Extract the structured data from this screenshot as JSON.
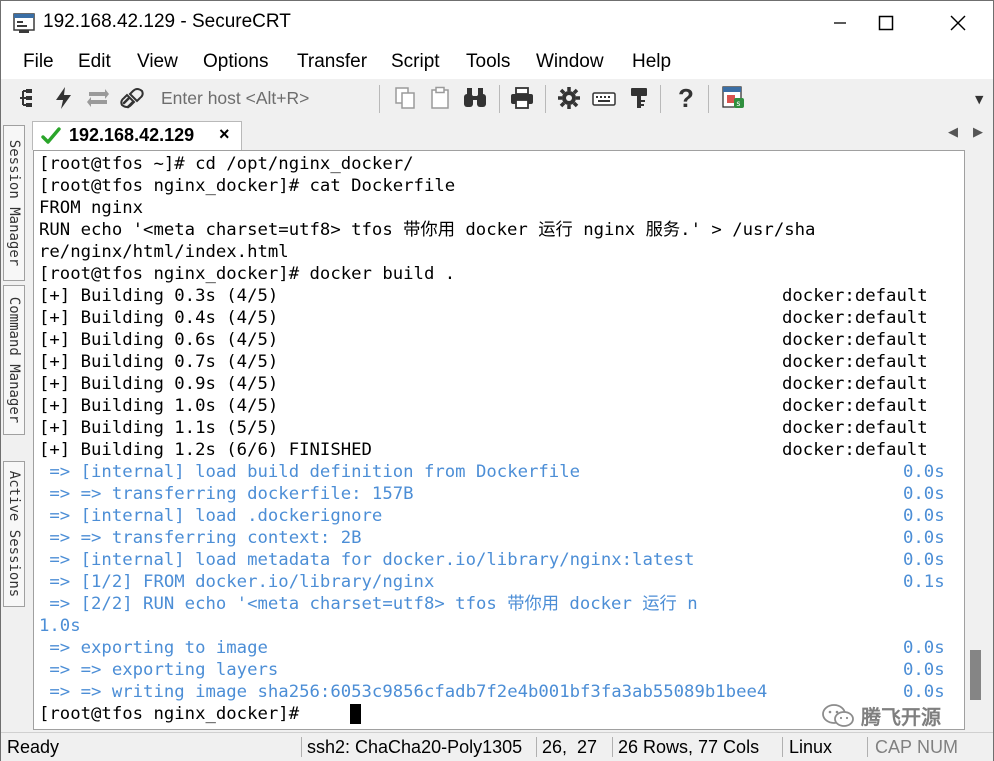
{
  "window": {
    "title": "192.168.42.129 - SecureCRT"
  },
  "menu": [
    "File",
    "Edit",
    "View",
    "Options",
    "Transfer",
    "Script",
    "Tools",
    "Window",
    "Help"
  ],
  "toolbar": {
    "host_placeholder": "Enter host <Alt+R>"
  },
  "side_panel": {
    "tabs": [
      "Session Manager",
      "Command Manager",
      "Active Sessions"
    ]
  },
  "tabs": [
    {
      "label": "192.168.42.129",
      "close": "×",
      "status": "connected"
    }
  ],
  "terminal": {
    "lines": [
      "[root@tfos ~]# cd /opt/nginx_docker/",
      "[root@tfos nginx_docker]# cat Dockerfile",
      "FROM nginx",
      "RUN echo '<meta charset=utf8> tfos 带你用 docker 运行 nginx 服务.' > /usr/sha",
      "re/nginx/html/index.html",
      "[root@tfos nginx_docker]# docker build ."
    ],
    "build_progress": [
      {
        "text": "[+] Building 0.3s (4/5)",
        "target": "docker:default"
      },
      {
        "text": "[+] Building 0.4s (4/5)",
        "target": "docker:default"
      },
      {
        "text": "[+] Building 0.6s (4/5)",
        "target": "docker:default"
      },
      {
        "text": "[+] Building 0.7s (4/5)",
        "target": "docker:default"
      },
      {
        "text": "[+] Building 0.9s (4/5)",
        "target": "docker:default"
      },
      {
        "text": "[+] Building 1.0s (4/5)",
        "target": "docker:default"
      },
      {
        "text": "[+] Building 1.1s (5/5)",
        "target": "docker:default"
      },
      {
        "text": "[+] Building 1.2s (6/6) FINISHED",
        "target": "docker:default"
      }
    ],
    "steps": [
      {
        "text": " => [internal] load build definition from Dockerfile",
        "time": "0.0s"
      },
      {
        "text": " => => transferring dockerfile: 157B",
        "time": "0.0s"
      },
      {
        "text": " => [internal] load .dockerignore",
        "time": "0.0s"
      },
      {
        "text": " => => transferring context: 2B",
        "time": "0.0s"
      },
      {
        "text": " => [internal] load metadata for docker.io/library/nginx:latest",
        "time": "0.0s"
      },
      {
        "text": " => [1/2] FROM docker.io/library/nginx",
        "time": "0.1s"
      },
      {
        "text": " => [2/2] RUN echo '<meta charset=utf8> tfos 带你用 docker 运行 n",
        "time": ""
      },
      {
        "text": "1.0s",
        "time": ""
      },
      {
        "text": " => exporting to image",
        "time": "0.0s"
      },
      {
        "text": " => => exporting layers",
        "time": "0.0s"
      },
      {
        "text": " => => writing image sha256:6053c9856cfadb7f2e4b001bf3fa3ab55089b1bee4",
        "time": "0.0s"
      }
    ],
    "prompt": "[root@tfos nginx_docker]# "
  },
  "watermark": {
    "text": "腾飞开源"
  },
  "status": {
    "state": "Ready",
    "protocol": "ssh2: ChaCha20-Poly1305",
    "cursor": "26,  27",
    "size": "26 Rows, 77 Cols",
    "os": "Linux",
    "cap": "CAP",
    "num": "NUM"
  },
  "colors": {
    "output_blue": "#4c8ed6",
    "check_green": "#2aa52a"
  }
}
